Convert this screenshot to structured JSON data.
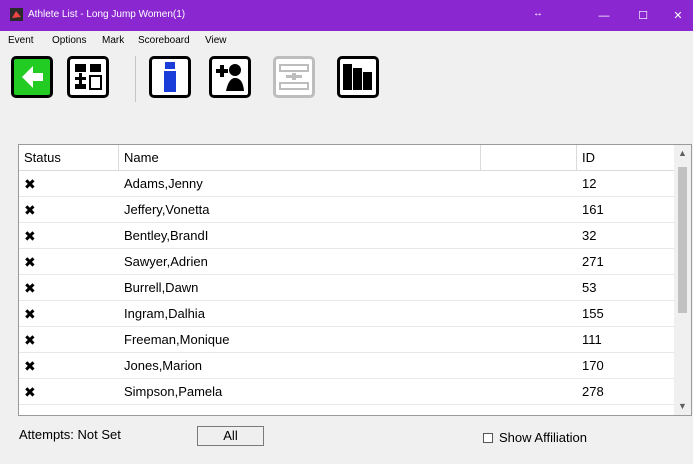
{
  "window": {
    "title": "Athlete List - Long Jump Women(1)",
    "resize_glyph": "↔",
    "buttons": {
      "minimize": "—",
      "maximize": "☐",
      "close": "✕"
    }
  },
  "menu": [
    "Event",
    "Options",
    "Mark",
    "Scoreboard",
    "View"
  ],
  "toolbar": {
    "icons": [
      "back-arrow-icon",
      "flowchart-icon",
      "info-icon",
      "add-athlete-icon",
      "measure-icon",
      "rank-order-icon"
    ]
  },
  "list": {
    "columns": [
      "Status",
      "Name",
      "",
      "ID"
    ],
    "rows": [
      {
        "status": "✖",
        "name": "Adams,Jenny",
        "id": "12"
      },
      {
        "status": "✖",
        "name": "Jeffery,Vonetta",
        "id": "161"
      },
      {
        "status": "✖",
        "name": "Bentley,BrandI",
        "id": "32"
      },
      {
        "status": "✖",
        "name": "Sawyer,Adrien",
        "id": "271"
      },
      {
        "status": "✖",
        "name": "Burrell,Dawn",
        "id": "53"
      },
      {
        "status": "✖",
        "name": "Ingram,Dalhia",
        "id": "155"
      },
      {
        "status": "✖",
        "name": "Freeman,Monique",
        "id": "111"
      },
      {
        "status": "✖",
        "name": "Jones,Marion",
        "id": "170"
      },
      {
        "status": "✖",
        "name": "Simpson,Pamela",
        "id": "278"
      }
    ]
  },
  "footer": {
    "attempts": "Attempts: Not Set",
    "all_button": "All",
    "show_affiliation": "Show Affiliation"
  },
  "colors": {
    "titlebar": "#8a27d0",
    "back_button": "#22cc22"
  }
}
